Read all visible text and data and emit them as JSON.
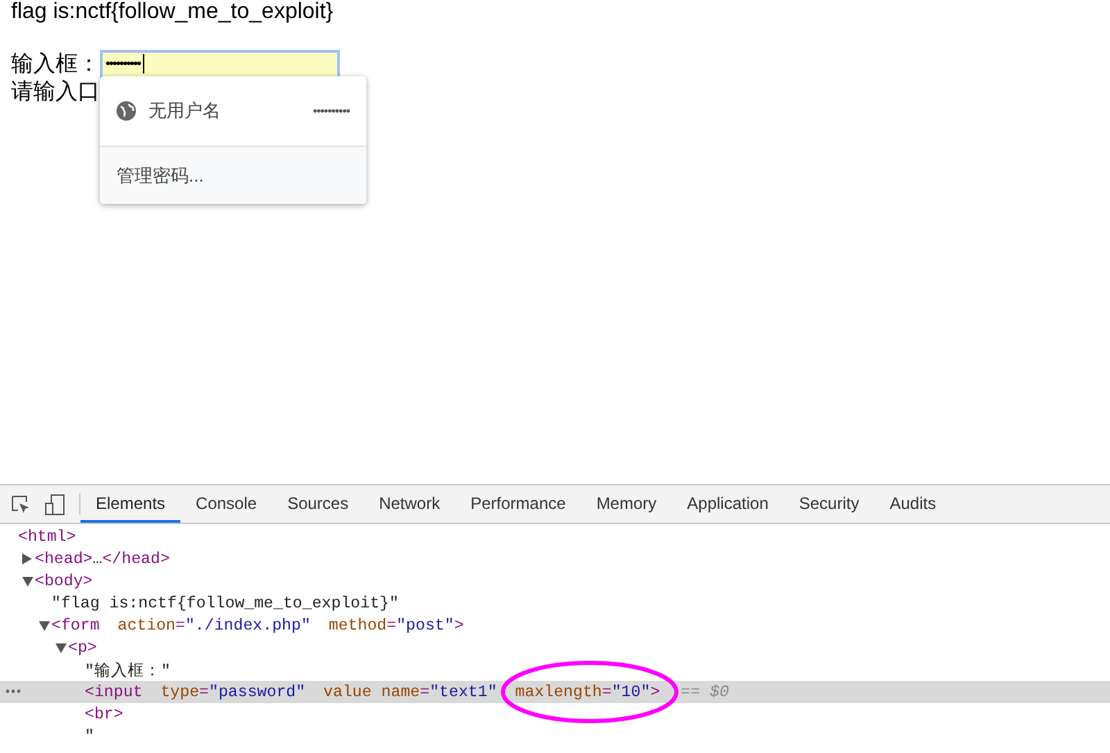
{
  "page": {
    "flag_text": "flag is:nctf{follow_me_to_exploit}",
    "field_label": "输入框：",
    "field": {
      "value_masked": "••••••••••",
      "focused": true,
      "autofilled": true
    },
    "second_label": "请输入口"
  },
  "autofill_popup": {
    "entries": [
      {
        "username": "无用户名",
        "password_masked": "••••••••••"
      }
    ],
    "footer": "管理密码..."
  },
  "devtools": {
    "tabs": [
      {
        "label": "Elements",
        "selected": true
      },
      {
        "label": "Console",
        "selected": false
      },
      {
        "label": "Sources",
        "selected": false
      },
      {
        "label": "Network",
        "selected": false
      },
      {
        "label": "Performance",
        "selected": false
      },
      {
        "label": "Memory",
        "selected": false
      },
      {
        "label": "Application",
        "selected": false
      },
      {
        "label": "Security",
        "selected": false
      },
      {
        "label": "Audits",
        "selected": false
      }
    ],
    "tree": [
      {
        "tokens": [
          {
            "kind": "tag",
            "text": "<html>"
          }
        ],
        "children": [
          {
            "expanded": false,
            "tokens": [
              {
                "kind": "tag",
                "text": "<head>"
              },
              {
                "kind": "plain",
                "text": "…"
              },
              {
                "kind": "tag",
                "text": "</head>"
              }
            ]
          },
          {
            "expanded": true,
            "tokens": [
              {
                "kind": "tag",
                "text": "<body>"
              }
            ],
            "children": [
              {
                "tokens": [
                  {
                    "kind": "plain",
                    "text": "\"flag is:nctf{follow_me_to_exploit}\""
                  }
                ]
              },
              {
                "expanded": true,
                "tokens": [
                  {
                    "kind": "tag",
                    "text": "<form"
                  },
                  {
                    "kind": "attr",
                    "text": " action"
                  },
                  {
                    "kind": "tag",
                    "text": "="
                  },
                  {
                    "kind": "value",
                    "text": "\"./index.php\""
                  },
                  {
                    "kind": "attr",
                    "text": " method"
                  },
                  {
                    "kind": "tag",
                    "text": "="
                  },
                  {
                    "kind": "value",
                    "text": "\"post\""
                  },
                  {
                    "kind": "tag",
                    "text": ">"
                  }
                ],
                "children": [
                  {
                    "expanded": true,
                    "tokens": [
                      {
                        "kind": "tag",
                        "text": "<p>"
                      }
                    ],
                    "children": [
                      {
                        "tokens": [
                          {
                            "kind": "plain",
                            "text": "\"输入框：\""
                          }
                        ]
                      },
                      {
                        "selected": true,
                        "tokens": [
                          {
                            "kind": "tag",
                            "text": "<input"
                          },
                          {
                            "kind": "attr",
                            "text": " type"
                          },
                          {
                            "kind": "tag",
                            "text": "="
                          },
                          {
                            "kind": "value",
                            "text": "\"password\""
                          },
                          {
                            "kind": "attr",
                            "text": " value name"
                          },
                          {
                            "kind": "tag",
                            "text": "="
                          },
                          {
                            "kind": "value",
                            "text": "\"text1\""
                          },
                          {
                            "kind": "attr",
                            "text": " maxlength"
                          },
                          {
                            "kind": "tag",
                            "text": "="
                          },
                          {
                            "kind": "value",
                            "text": "\"10\""
                          },
                          {
                            "kind": "tag",
                            "text": ">"
                          },
                          {
                            "kind": "hint",
                            "text": " == $0"
                          }
                        ]
                      },
                      {
                        "tokens": [
                          {
                            "kind": "tag",
                            "text": "<br>"
                          }
                        ]
                      },
                      {
                        "tokens": [
                          {
                            "kind": "plain",
                            "text": "\""
                          }
                        ]
                      }
                    ]
                  }
                ]
              }
            ]
          }
        ]
      }
    ]
  }
}
